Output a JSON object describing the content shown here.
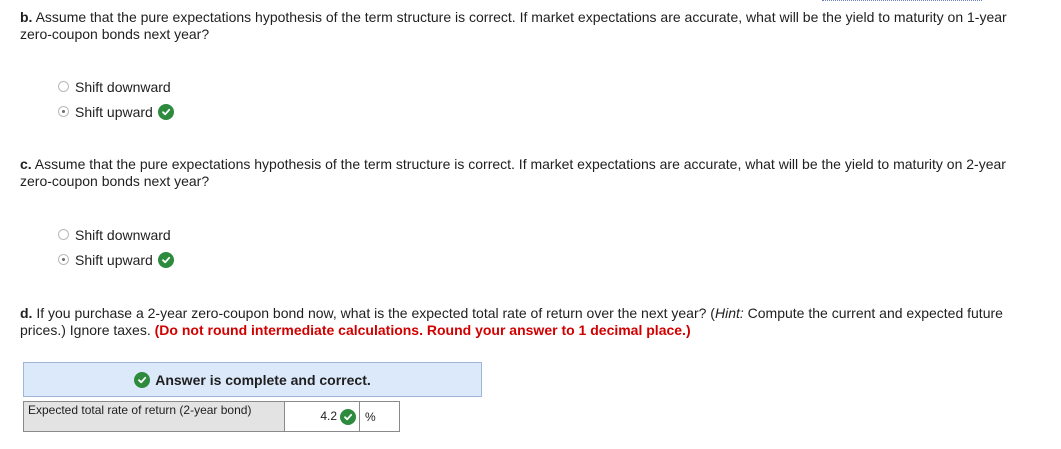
{
  "question_b": {
    "letter": "b.",
    "text": " Assume that the pure expectations hypothesis of the term structure is correct. If market expectations are accurate, what will be the yield to maturity on 1-year zero-coupon bonds next year?",
    "options": [
      {
        "label": "Shift downward",
        "selected": false
      },
      {
        "label": "Shift upward",
        "selected": true
      }
    ]
  },
  "question_c": {
    "letter": "c.",
    "text": " Assume that the pure expectations hypothesis of the term structure is correct. If market expectations are accurate, what will be the yield to maturity on 2-year zero-coupon bonds next year?",
    "options": [
      {
        "label": "Shift downward",
        "selected": false
      },
      {
        "label": "Shift upward",
        "selected": true
      }
    ]
  },
  "question_d": {
    "letter": "d.",
    "text_before_hint": " If you purchase a 2-year zero-coupon bond now, what is the expected total rate of return over the next year? (",
    "hint_label": "Hint:",
    "text_after_hint": " Compute the current and expected future prices.) Ignore taxes. ",
    "instruction": "(Do not round intermediate calculations. Round your answer to 1 decimal place.)"
  },
  "answer": {
    "status": "Answer is complete and correct.",
    "row_label": "Expected total rate of return (2-year bond)",
    "value": "4.2",
    "unit": "%"
  },
  "colors": {
    "correct_green": "#2e8b3e",
    "instruction_red": "#d10000",
    "answer_header_bg": "#dce9fa"
  }
}
